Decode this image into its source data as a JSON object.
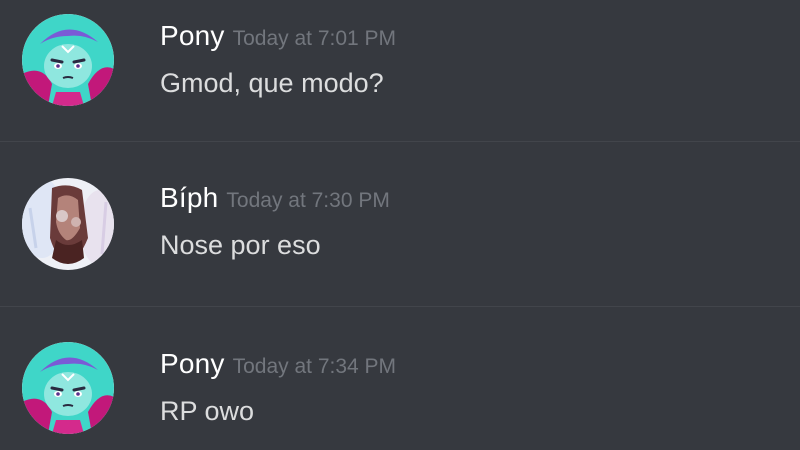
{
  "colors": {
    "background": "#36393f",
    "divider": "#42454b",
    "username": "#ffffff",
    "timestamp": "#72767d",
    "message_text": "#dcddde",
    "pony_avatar_bg": "#3fd6c8",
    "pony_avatar_accent": "#c2187a"
  },
  "messages": [
    {
      "author": "Pony",
      "timestamp": "Today at 7:01 PM",
      "text": "Gmod, que modo?",
      "avatar_icon": "pony-avatar-icon"
    },
    {
      "author": "Bíph",
      "timestamp": "Today at 7:30 PM",
      "text": "Nose por eso",
      "avatar_icon": "biph-avatar-icon"
    },
    {
      "author": "Pony",
      "timestamp": "Today at 7:34 PM",
      "text": "RP owo",
      "avatar_icon": "pony-avatar-icon"
    }
  ]
}
